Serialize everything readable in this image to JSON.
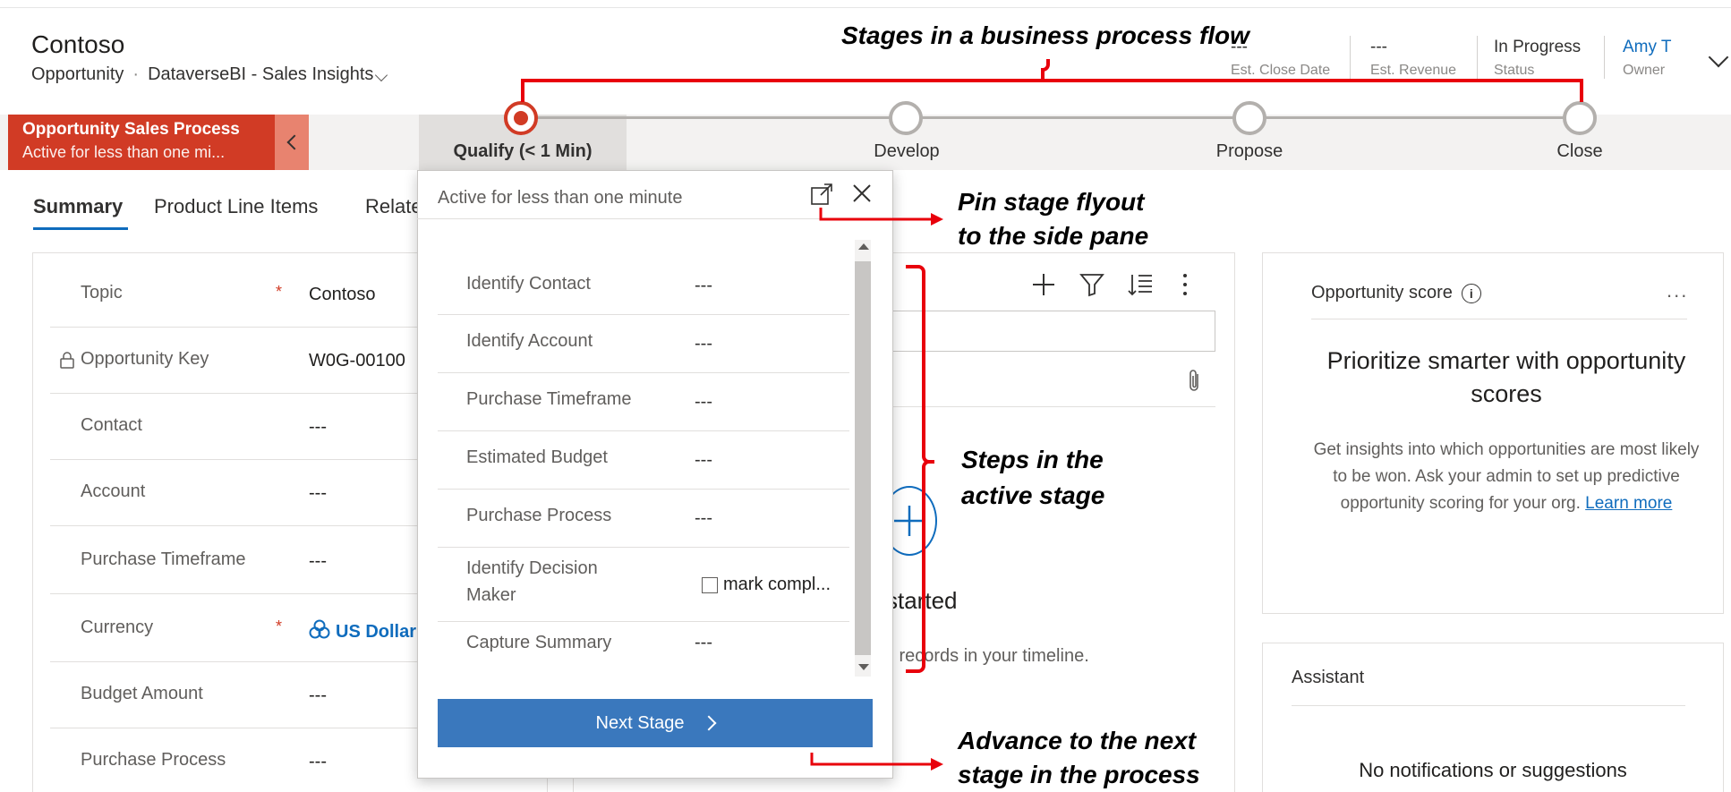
{
  "header": {
    "title": "Contoso",
    "entity": "Opportunity",
    "form": "DataverseBI - Sales Insights",
    "fields": [
      {
        "value": "---",
        "label": "Est. Close Date"
      },
      {
        "value": "---",
        "label": "Est. Revenue"
      },
      {
        "value": "In Progress",
        "label": "Status"
      },
      {
        "value": "Amy T",
        "label": "Owner"
      }
    ]
  },
  "process": {
    "name": "Opportunity Sales Process",
    "duration": "Active for less than one mi...",
    "stages": [
      {
        "label": "Qualify  (< 1 Min)",
        "active": true
      },
      {
        "label": "Develop"
      },
      {
        "label": "Propose"
      },
      {
        "label": "Close"
      }
    ]
  },
  "tabs": [
    "Summary",
    "Product Line Items",
    "Relate"
  ],
  "form": {
    "rows": [
      {
        "label": "Topic",
        "value": "Contoso",
        "required": true
      },
      {
        "label": "Opportunity Key",
        "value": "W0G-00100",
        "locked": true
      },
      {
        "label": "Contact",
        "value": "---"
      },
      {
        "label": "Account",
        "value": "---"
      },
      {
        "label": "Purchase Timeframe",
        "value": "---"
      },
      {
        "label": "Currency",
        "value": "US Dollar",
        "required": true,
        "link": true
      },
      {
        "label": "Budget Amount",
        "value": "---"
      },
      {
        "label": "Purchase Process",
        "value": "---"
      }
    ]
  },
  "flyout": {
    "header": "Active for less than one minute",
    "steps": [
      {
        "label": "Identify Contact",
        "value": "---"
      },
      {
        "label": "Identify Account",
        "value": "---"
      },
      {
        "label": "Purchase Timeframe",
        "value": "---"
      },
      {
        "label": "Estimated Budget",
        "value": "---"
      },
      {
        "label": "Purchase Process",
        "value": "---"
      },
      {
        "label": "Identify Decision Maker",
        "checkbox_label": "mark compl..."
      },
      {
        "label": "Capture Summary",
        "value": "---"
      }
    ],
    "next_label": "Next Stage"
  },
  "timeline": {
    "started_text": "started",
    "records_text": "ll records in your timeline."
  },
  "score": {
    "title": "Opportunity score",
    "more": "...",
    "heading": "Prioritize smarter with opportunity scores",
    "desc": "Get insights into which opportunities are most likely to be won. Ask your admin to set up predictive opportunity scoring for your org.",
    "link": "Learn more"
  },
  "assistant": {
    "title": "Assistant",
    "empty": "No notifications or suggestions"
  },
  "annotations": {
    "stages": "Stages in a business process flow",
    "pin_line1": "Pin stage flyout",
    "pin_line2": "to the side pane",
    "steps_line1": "Steps in the",
    "steps_line2": "active stage",
    "advance_line1": "Advance to the next",
    "advance_line2": "stage in the process"
  },
  "colors": {
    "process_red": "#d13b25",
    "brand_blue": "#0f6cbd",
    "annotation_red": "#e8000b"
  }
}
